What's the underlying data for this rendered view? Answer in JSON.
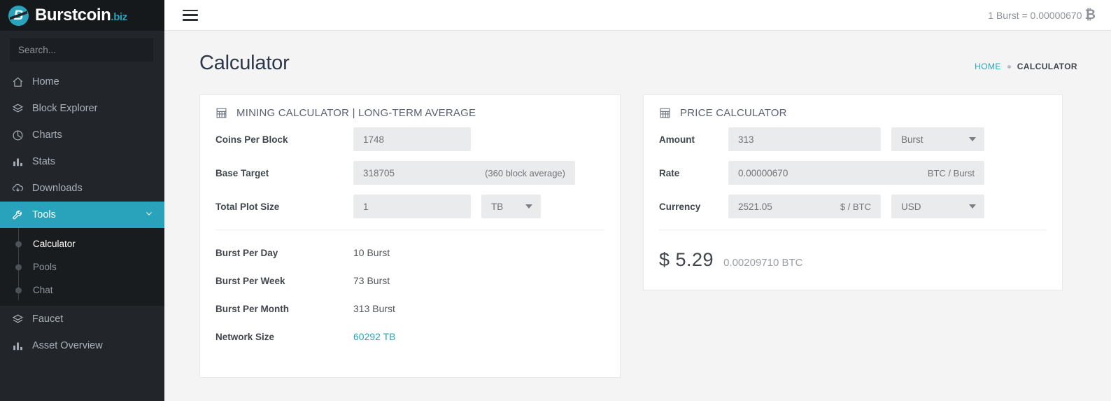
{
  "brand": {
    "name": "Burstcoin",
    "suffix": ".biz",
    "logo_icon": "burstcoin-logo-icon"
  },
  "search": {
    "placeholder": "Search...",
    "value": ""
  },
  "sidebar": {
    "items": [
      {
        "label": "Home",
        "icon": "home-icon"
      },
      {
        "label": "Block Explorer",
        "icon": "layers-icon"
      },
      {
        "label": "Charts",
        "icon": "pie-chart-icon"
      },
      {
        "label": "Stats",
        "icon": "bar-chart-icon"
      },
      {
        "label": "Downloads",
        "icon": "cloud-download-icon"
      },
      {
        "label": "Tools",
        "icon": "wrench-icon",
        "active": true,
        "chevron": "chevron-down-icon"
      },
      {
        "label": "Faucet",
        "icon": "layers-icon"
      },
      {
        "label": "Asset Overview",
        "icon": "bar-chart-icon"
      }
    ],
    "submenu": [
      {
        "label": "Calculator",
        "active": true
      },
      {
        "label": "Pools",
        "active": false
      },
      {
        "label": "Chat",
        "active": false
      }
    ]
  },
  "topbar": {
    "menu_icon": "hamburger-menu-icon",
    "rate_text": "1 Burst = 0.00000670",
    "rate_symbol": "₿"
  },
  "page": {
    "title": "Calculator",
    "breadcrumb": {
      "home": "HOME",
      "current": "CALCULATOR"
    }
  },
  "mining_card": {
    "title": "MINING CALCULATOR | LONG-TERM AVERAGE",
    "icon": "table-grid-icon",
    "fields": [
      {
        "label": "Coins Per Block",
        "value": "1748"
      },
      {
        "label": "Base Target",
        "value": "318705",
        "suffix": "(360 block average)"
      },
      {
        "label": "Total Plot Size",
        "value": "1",
        "unit": "TB"
      }
    ],
    "results": [
      {
        "label": "Burst Per Day",
        "value": "10 Burst"
      },
      {
        "label": "Burst Per Week",
        "value": "73 Burst"
      },
      {
        "label": "Burst Per Month",
        "value": "313 Burst"
      },
      {
        "label": "Network Size",
        "value": "60292 TB",
        "link": true
      }
    ]
  },
  "price_card": {
    "title": "PRICE CALCULATOR",
    "icon": "table-grid-icon",
    "fields": [
      {
        "label": "Amount",
        "value": "313",
        "unit": "Burst"
      },
      {
        "label": "Rate",
        "value": "0.00000670",
        "suffix": "BTC / Burst"
      },
      {
        "label": "Currency",
        "value": "2521.05",
        "suffix": "$ / BTC",
        "unit": "USD"
      }
    ],
    "result": {
      "fiat": "$ 5.29",
      "btc": "0.00209710 BTC"
    }
  },
  "colors": {
    "accent": "#29a3bb",
    "sidebar": "#22262a",
    "page_bg": "#f4f4f4"
  }
}
